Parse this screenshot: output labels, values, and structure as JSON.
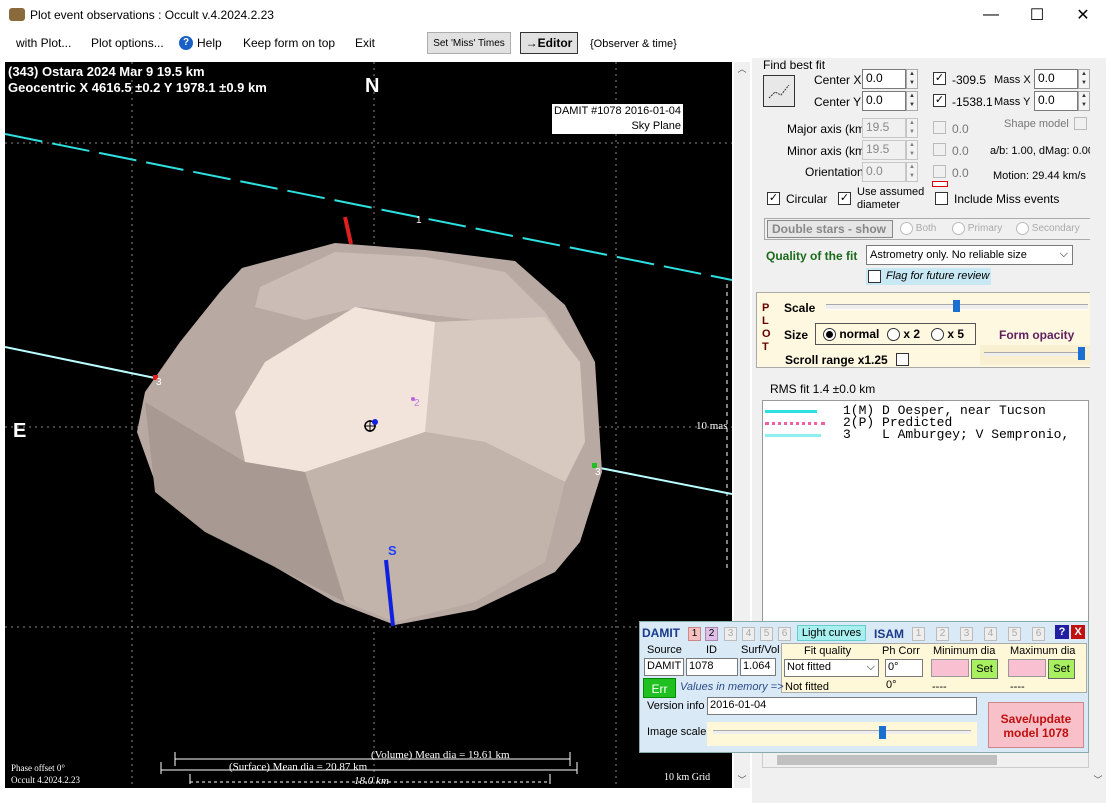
{
  "window": {
    "title": "Plot event observations : Occult v.4.2024.2.23",
    "minimize": "—",
    "maximize": "☐",
    "close": "✕"
  },
  "menu": {
    "with_plot": "with Plot...",
    "plot_options": "Plot options...",
    "help": "Help",
    "keep_on_top": "Keep form on top",
    "exit": "Exit",
    "set_miss": "Set 'Miss' Times",
    "editor": "→Editor",
    "observer_time": "{Observer & time}"
  },
  "plot": {
    "title_line1": "(343) Ostara  2024 Mar 9   19.5 km",
    "title_line2": "Geocentric  X  4616.5 ±0.2  Y 1978.1 ±0.9 km",
    "north": "N",
    "east": "E",
    "south": "S",
    "damit_label1": "DAMIT #1078 2016-01-04",
    "damit_label2": "Sky Plane",
    "chord1": "1",
    "chord2": "2",
    "chord3a": "3",
    "chord3b": "3",
    "mas_label": "10 mas",
    "volume_dia": "(Volume) Mean dia = 19.61 km",
    "surface_dia": "(Surface) Mean dia = 20.87 km",
    "scale_km": "18.0 km",
    "phase_offset": "Phase offset 0°",
    "version": "Occult 4.2024.2.23",
    "grid": "10 km Grid"
  },
  "fit": {
    "heading": "Find best fit",
    "center_x_label": "Center X",
    "center_x": "0.0",
    "center_y_label": "Center Y",
    "center_y": "0.0",
    "x_val": "-309.5",
    "y_val": "-1538.1",
    "mass_x_label": "Mass X",
    "mass_x": "0.0",
    "mass_y_label": "Mass Y",
    "mass_y": "0.0",
    "major_label": "Major axis (km)",
    "major": "19.5",
    "major_chk": "0.0",
    "minor_label": "Minor axis (km)",
    "minor": "19.5",
    "minor_chk": "0.0",
    "orient_label": "Orientation",
    "orient": "0.0",
    "orient_chk": "0.0",
    "shape_model": "Shape model",
    "ab": "a/b: 1.00, dMag: 0.00",
    "motion": "Motion: 29.44 km/s",
    "circular": "Circular",
    "use_assumed": "Use assumed",
    "diameter": "diameter",
    "include_miss": "Include Miss events"
  },
  "double_stars": {
    "label": "Double stars - show",
    "both": "Both",
    "primary": "Primary",
    "secondary": "Secondary"
  },
  "quality": {
    "label": "Quality of the fit",
    "value": "Astrometry only. No reliable size",
    "flag": "Flag for future review"
  },
  "plotbox": {
    "p": "P",
    "l": "L",
    "o": "O",
    "t": "T",
    "scale": "Scale",
    "size": "Size",
    "normal": "normal",
    "x2": "x 2",
    "x5": "x 5",
    "form_opacity": "Form opacity",
    "scroll_range": "Scroll range x1.25"
  },
  "rms": "RMS fit 1.4 ±0.0 km",
  "observers": [
    {
      "id": "1(M)",
      "name": "D Oesper, near Tucson"
    },
    {
      "id": "2(P)",
      "name": "Predicted"
    },
    {
      "id": "3",
      "name": "L Amburgey; V Sempronio,"
    }
  ],
  "damit": {
    "label": "DAMIT",
    "tabs": [
      "1",
      "2",
      "3",
      "4",
      "5",
      "6"
    ],
    "light_curves": "Light curves",
    "isam": "ISAM",
    "isam_tabs": [
      "1",
      "2",
      "3",
      "4",
      "5",
      "6"
    ],
    "help": "?",
    "close": "X",
    "source_label": "Source",
    "id_label": "ID",
    "surf_label": "Surf/Vol",
    "fit_quality_label": "Fit quality",
    "ph_corr_label": "Ph Corr",
    "min_dia_label": "Minimum dia",
    "max_dia_label": "Maximum dia",
    "source": "DAMIT",
    "id": "1078",
    "surf": "1.064",
    "fit_quality": "Not fitted",
    "ph_corr": "0°",
    "set": "Set",
    "err": "Err",
    "values_mem": "Values in memory =>",
    "fit_quality2": "Not fitted",
    "ph_corr2": "0°",
    "min2": "----",
    "max2": "----",
    "version_label": "Version info",
    "version": "2016-01-04",
    "image_scale": "Image scale",
    "save1": "Save/update",
    "save2": "model 1078"
  }
}
